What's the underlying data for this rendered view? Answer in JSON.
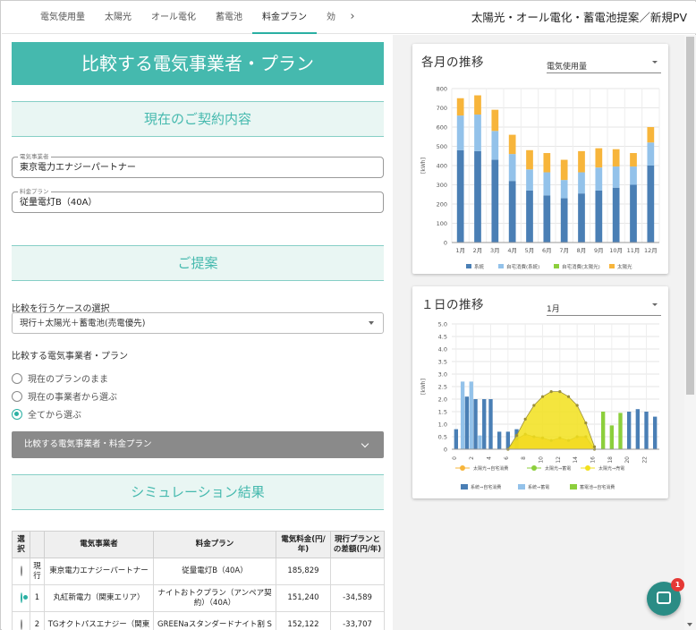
{
  "nav": {
    "tabs": [
      {
        "label": "電気使用量"
      },
      {
        "label": "太陽光"
      },
      {
        "label": "オール電化"
      },
      {
        "label": "蓄電池"
      },
      {
        "label": "料金プラン"
      },
      {
        "label": "効"
      }
    ],
    "more_icon": "chevron-right-icon",
    "title": "太陽光・オール電化・蓄電池提案／新規PV"
  },
  "left": {
    "banner": "比較する電気事業者・プラン",
    "current_section": "現在のご契約内容",
    "provider_field": {
      "label": "電気事業者",
      "value": "東京電力エナジーパートナー"
    },
    "plan_field": {
      "label": "料金プラン",
      "value": "従量電灯B（40A）"
    },
    "proposal_section": "ご提案",
    "case_label": "比較を行うケースの選択",
    "case_value": "現行＋太陽光＋蓄電池(売電優先)",
    "compare_label": "比較する電気事業者・プラン",
    "radios": [
      {
        "label": "現在のプランのまま",
        "selected": false
      },
      {
        "label": "現在の事業者から選ぶ",
        "selected": false
      },
      {
        "label": "全てから選ぶ",
        "selected": true
      }
    ],
    "accordion_label": "比較する電気事業者・料金プラン",
    "sim_section": "シミュレーション結果",
    "table": {
      "headers": [
        "選択",
        "",
        "電気事業者",
        "料金プラン",
        "電気料金(円/年)",
        "現行プランとの差額(円/年)"
      ],
      "rows": [
        {
          "selected": false,
          "no": "現行",
          "provider": "東京電力エナジーパートナー",
          "plan": "従量電灯B（40A）",
          "fee": "185,829",
          "diff": ""
        },
        {
          "selected": true,
          "no": "1",
          "provider": "丸紅新電力（関東エリア）",
          "plan": "ナイトおトクプラン（アンペア契約）（40A）",
          "fee": "151,240",
          "diff": "-34,589"
        },
        {
          "selected": false,
          "no": "2",
          "provider": "TGオクトパスエナジー（関東",
          "plan": "GREENaスタンダードナイト割 S",
          "fee": "152,122",
          "diff": "-33,707"
        }
      ]
    }
  },
  "monthly_card": {
    "title": "各月の推移",
    "select_value": "電気使用量"
  },
  "daily_card": {
    "title": "１日の推移",
    "select_value": "1月"
  },
  "chart_data": [
    {
      "type": "bar",
      "stacked": true,
      "title": "",
      "xlabel": "",
      "ylabel": "[kWh]",
      "ylim": [
        0,
        800
      ],
      "yticks": [
        0,
        100,
        200,
        300,
        400,
        500,
        600,
        700,
        800
      ],
      "categories": [
        "1月",
        "2月",
        "3月",
        "4月",
        "5月",
        "6月",
        "7月",
        "8月",
        "9月",
        "10月",
        "11月",
        "12月"
      ],
      "series": [
        {
          "name": "系統",
          "color": "#4a7fb5",
          "values": [
            480,
            475,
            430,
            320,
            270,
            245,
            230,
            255,
            270,
            285,
            300,
            400
          ]
        },
        {
          "name": "自宅消費(系統)",
          "color": "#93c2ea",
          "values": [
            180,
            190,
            150,
            140,
            110,
            120,
            95,
            110,
            120,
            110,
            95,
            120
          ]
        },
        {
          "name": "自宅消費(太陽光)",
          "color": "#8ccf3c",
          "values": [
            0,
            0,
            0,
            0,
            0,
            0,
            0,
            0,
            0,
            0,
            0,
            0
          ]
        },
        {
          "name": "太陽光",
          "color": "#f7b53b",
          "values": [
            90,
            100,
            110,
            100,
            100,
            100,
            105,
            110,
            100,
            90,
            70,
            80
          ]
        }
      ],
      "legend": "bottom",
      "grid": true
    },
    {
      "type": "bar",
      "title": "",
      "xlabel": "",
      "ylabel": "[kWh]",
      "ylim": [
        0,
        5
      ],
      "yticks": [
        0,
        0.5,
        1.0,
        1.5,
        2.0,
        2.5,
        3.0,
        3.5,
        4.0,
        4.5,
        5.0
      ],
      "ytick_labels": [
        "0",
        "0.5",
        "1.0",
        "1.5",
        "2.0",
        "2.5",
        "3.0",
        "3.5",
        "4.0",
        "4.5",
        "5.0"
      ],
      "categories": [
        "0",
        "1",
        "2",
        "3",
        "4",
        "5",
        "6",
        "7",
        "8",
        "9",
        "10",
        "11",
        "12",
        "13",
        "14",
        "15",
        "16",
        "17",
        "18",
        "19",
        "20",
        "21",
        "22",
        "23"
      ],
      "xtick_labels": [
        "0",
        "2",
        "4",
        "6",
        "8",
        "10",
        "12",
        "14",
        "16",
        "18",
        "20",
        "22"
      ],
      "series": [
        {
          "name": "系統⇒自宅消費",
          "color": "#4a7fb5",
          "values": [
            0.8,
            2.1,
            2.0,
            2.0,
            2.0,
            0.7,
            0.7,
            0.8,
            0,
            0,
            0,
            0,
            0,
            0,
            0,
            0,
            0,
            0,
            0,
            0,
            1.5,
            1.6,
            1.5,
            1.3
          ]
        },
        {
          "name": "系統⇒蓄電",
          "color": "#93c2ea",
          "values": [
            0,
            2.7,
            2.7,
            0.55,
            0,
            0,
            0,
            0,
            0,
            0,
            0,
            0,
            0,
            0,
            0,
            0,
            0,
            0,
            0,
            0,
            0,
            0,
            0,
            0
          ]
        },
        {
          "name": "蓄電池⇒自宅消費",
          "color": "#8ccf3c",
          "values": [
            0,
            0,
            0,
            0,
            0,
            0,
            0,
            0,
            0,
            0,
            0,
            0,
            0,
            0,
            0,
            0,
            0,
            1.5,
            0.95,
            1.45,
            0,
            0,
            0,
            0
          ]
        }
      ],
      "areas": [
        {
          "name": "太陽光⇒自宅消費",
          "color": "#f7b53b",
          "x": [
            6,
            7,
            8,
            9,
            10,
            11,
            12,
            13,
            14,
            15,
            16
          ],
          "values": [
            0,
            0.4,
            0.6,
            0.5,
            0.45,
            0.35,
            0.45,
            0.35,
            0.5,
            0.5,
            0
          ]
        },
        {
          "name": "太陽光⇒蓄電",
          "color": "#8ccf3c",
          "x": [],
          "values": []
        },
        {
          "name": "太陽光⇒売電",
          "color": "#f2e01c",
          "x": [
            6,
            7,
            8,
            9,
            10,
            11,
            12,
            13,
            14,
            15,
            16
          ],
          "values": [
            0,
            0.55,
            1.2,
            1.75,
            2.1,
            2.3,
            2.3,
            2.1,
            1.75,
            1.05,
            0.1
          ]
        }
      ],
      "legend": "bottom",
      "grid": true
    }
  ]
}
